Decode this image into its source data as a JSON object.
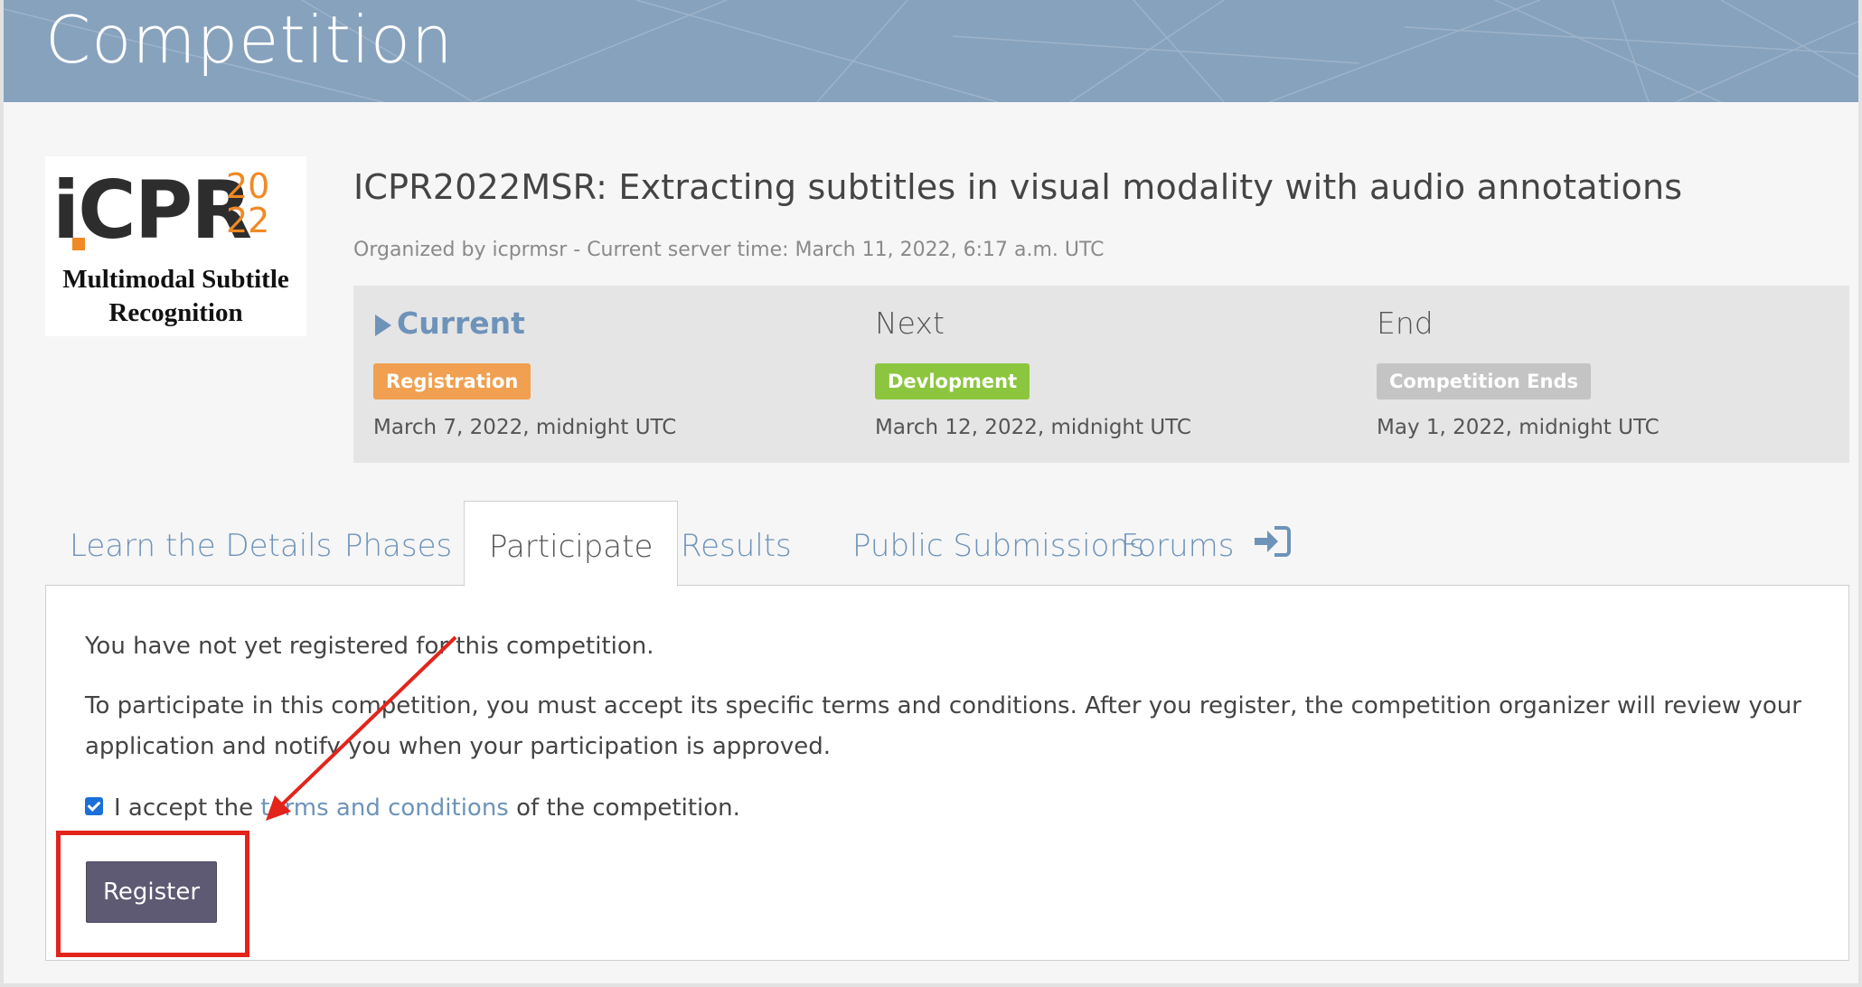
{
  "header": {
    "title": "Competition"
  },
  "logo": {
    "acronym": "iCPR",
    "year_top": "20",
    "year_bottom": "22",
    "subtitle_line1": "Multimodal Subtitle",
    "subtitle_line2": "Recognition"
  },
  "competition": {
    "title": "ICPR2022MSR: Extracting subtitles in visual modality with audio annotations",
    "organizer_line": "Organized by icprmsr - Current server time: March 11, 2022, 6:17 a.m. UTC"
  },
  "phases": [
    {
      "heading": "Current",
      "badge": "Registration",
      "badge_color": "#f0a050",
      "date": "March 7, 2022, midnight UTC"
    },
    {
      "heading": "Next",
      "badge": "Devlopment",
      "badge_color": "#8cc63f",
      "date": "March 12, 2022, midnight UTC"
    },
    {
      "heading": "End",
      "badge": "Competition Ends",
      "badge_color": "#c4c4c4",
      "date": "May 1, 2022, midnight UTC"
    }
  ],
  "tabs": [
    {
      "label": "Learn the Details",
      "active": false
    },
    {
      "label": "Phases",
      "active": false
    },
    {
      "label": "Participate",
      "active": true
    },
    {
      "label": "Results",
      "active": false
    },
    {
      "label": "Public Submissions",
      "active": false
    },
    {
      "label": "Forums",
      "active": false,
      "icon": "sign-in-icon"
    }
  ],
  "participate": {
    "not_registered": "You have not yet registered for this competition.",
    "instructions_line1": "To participate in this competition, you must accept its specific terms and conditions. After you register, the competition organizer will review your",
    "instructions_line2": "application and notify you when your participation is approved.",
    "accept_prefix": "I accept the",
    "terms_link": "terms and conditions",
    "accept_suffix": "of the competition.",
    "checkbox_checked": true,
    "register_label": "Register"
  },
  "colors": {
    "banner": "#87a2bd",
    "link": "#6e93b9",
    "register_button": "#5e5a73",
    "annotation": "#e3241b"
  }
}
